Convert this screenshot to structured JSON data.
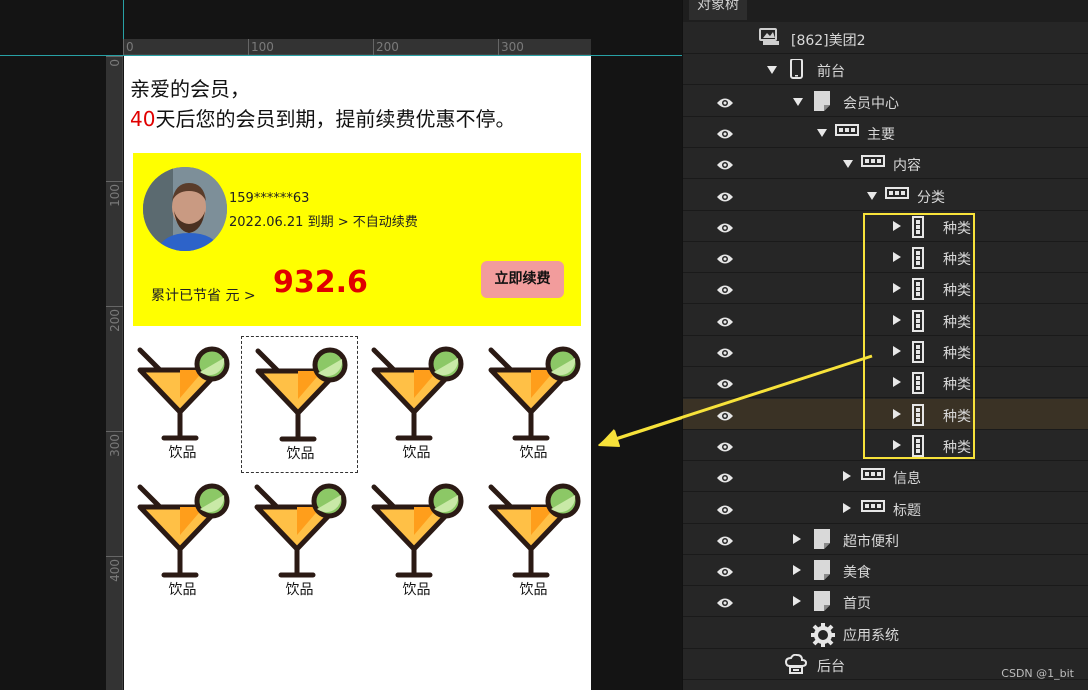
{
  "ruler": {
    "top_ticks": [
      "0",
      "100",
      "200",
      "300"
    ],
    "left_ticks": [
      "0",
      "100",
      "200",
      "300",
      "400"
    ]
  },
  "phone": {
    "greeting_line1": "亲爱的会员，",
    "days": "40",
    "greeting_line2": "天后您的会员到期，提前续费优惠不停。",
    "card": {
      "phone": "159******63",
      "expire": "2022.06.21 到期 > 不自动续费",
      "save_label": "累计已节省  元 >",
      "save_value": "932.6",
      "renew_button": "立即续费",
      "bg_color": "#ffff00"
    },
    "categories": [
      "饮品",
      "饮品",
      "饮品",
      "饮品",
      "饮品",
      "饮品",
      "饮品",
      "饮品"
    ],
    "category_icon": "cocktail-icon"
  },
  "panel": {
    "title": "对象树",
    "rows": [
      {
        "label": "[862]美团2",
        "icon": "project-icon",
        "eye": false,
        "toggle": "none"
      },
      {
        "label": "前台",
        "icon": "mobile-icon",
        "eye": false,
        "toggle": "down"
      },
      {
        "label": "会员中心",
        "icon": "page-icon",
        "eye": true,
        "toggle": "down"
      },
      {
        "label": "主要",
        "icon": "panel-icon",
        "eye": true,
        "toggle": "down"
      },
      {
        "label": "内容",
        "icon": "panel-icon",
        "eye": true,
        "toggle": "down"
      },
      {
        "label": "分类",
        "icon": "panel-icon",
        "eye": true,
        "toggle": "down"
      },
      {
        "label": "种类",
        "icon": "column-icon",
        "eye": true,
        "toggle": "right"
      },
      {
        "label": "种类",
        "icon": "column-icon",
        "eye": true,
        "toggle": "right"
      },
      {
        "label": "种类",
        "icon": "column-icon",
        "eye": true,
        "toggle": "right"
      },
      {
        "label": "种类",
        "icon": "column-icon",
        "eye": true,
        "toggle": "right"
      },
      {
        "label": "种类",
        "icon": "column-icon",
        "eye": true,
        "toggle": "right"
      },
      {
        "label": "种类",
        "icon": "column-icon",
        "eye": true,
        "toggle": "right"
      },
      {
        "label": "种类",
        "icon": "column-icon",
        "eye": true,
        "toggle": "right",
        "highlighted": true
      },
      {
        "label": "种类",
        "icon": "column-icon",
        "eye": true,
        "toggle": "right"
      },
      {
        "label": "信息",
        "icon": "panel-icon",
        "eye": true,
        "toggle": "right"
      },
      {
        "label": "标题",
        "icon": "panel-icon",
        "eye": true,
        "toggle": "right"
      },
      {
        "label": "超市便利",
        "icon": "page-icon",
        "eye": true,
        "toggle": "right"
      },
      {
        "label": "美食",
        "icon": "page-icon",
        "eye": true,
        "toggle": "right"
      },
      {
        "label": "首页",
        "icon": "page-icon",
        "eye": true,
        "toggle": "right"
      },
      {
        "label": "应用系统",
        "icon": "gear-icon",
        "eye": false,
        "toggle": "none"
      },
      {
        "label": "后台",
        "icon": "cloud-icon",
        "eye": false,
        "toggle": "none"
      }
    ]
  },
  "watermark": "CSDN @1_bit",
  "colors": {
    "accent_yellow": "#f7e23a",
    "days_red": "#e00000",
    "renew_pink": "#f29c9c"
  }
}
